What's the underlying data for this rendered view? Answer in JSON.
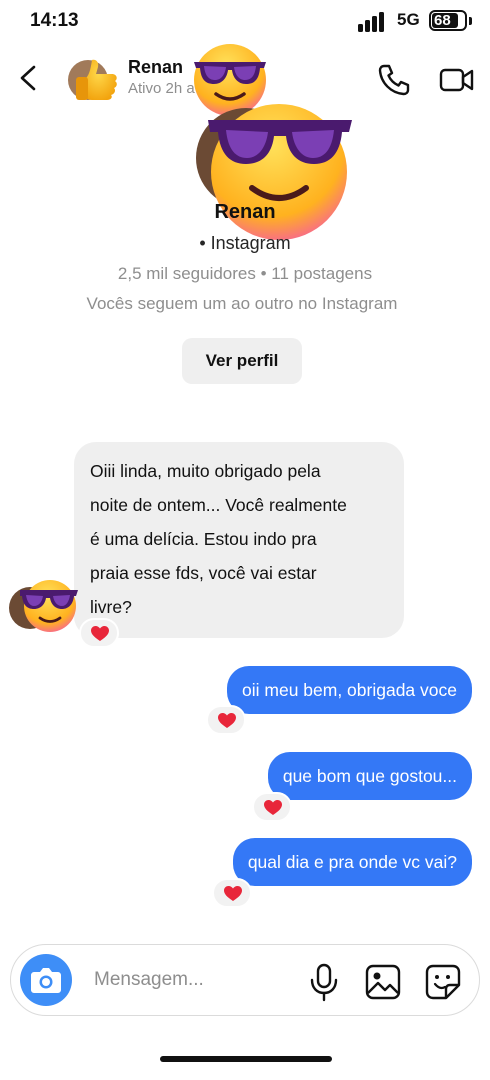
{
  "status_bar": {
    "time": "14:13",
    "network": "5G",
    "battery": "68"
  },
  "header": {
    "name": "Renan",
    "status": "Ativo 2h a",
    "avatar_icon": "thumbs-up-emoji",
    "overlay_icon": "sunglasses-emoji"
  },
  "profile": {
    "name": "Renan",
    "platform": "• Instagram",
    "stats": "2,5 mil seguidores • 11 postagens",
    "mutual": "Vocês seguem um ao outro no Instagram",
    "view_profile_label": "Ver perfil"
  },
  "messages": [
    {
      "direction": "incoming",
      "lines": [
        "Oiii linda, muito obrigado pela",
        "noite de ontem... Você realmente",
        "é uma delícia. Estou indo pra",
        "praia esse fds, você vai estar",
        "livre?"
      ],
      "reaction": "heart"
    },
    {
      "direction": "outgoing",
      "text": "oii meu bem, obrigada voce",
      "reaction": "heart"
    },
    {
      "direction": "outgoing",
      "text": "que bom que gostou...",
      "reaction": "heart"
    },
    {
      "direction": "outgoing",
      "text": "qual dia e pra onde vc vai?",
      "reaction": "heart"
    }
  ],
  "composer": {
    "placeholder": "Mensagem..."
  },
  "colors": {
    "outgoing_bubble": "#3478f6",
    "incoming_bubble": "#efefef",
    "camera_button": "#3e8ef7",
    "heart": "#e8263a"
  }
}
